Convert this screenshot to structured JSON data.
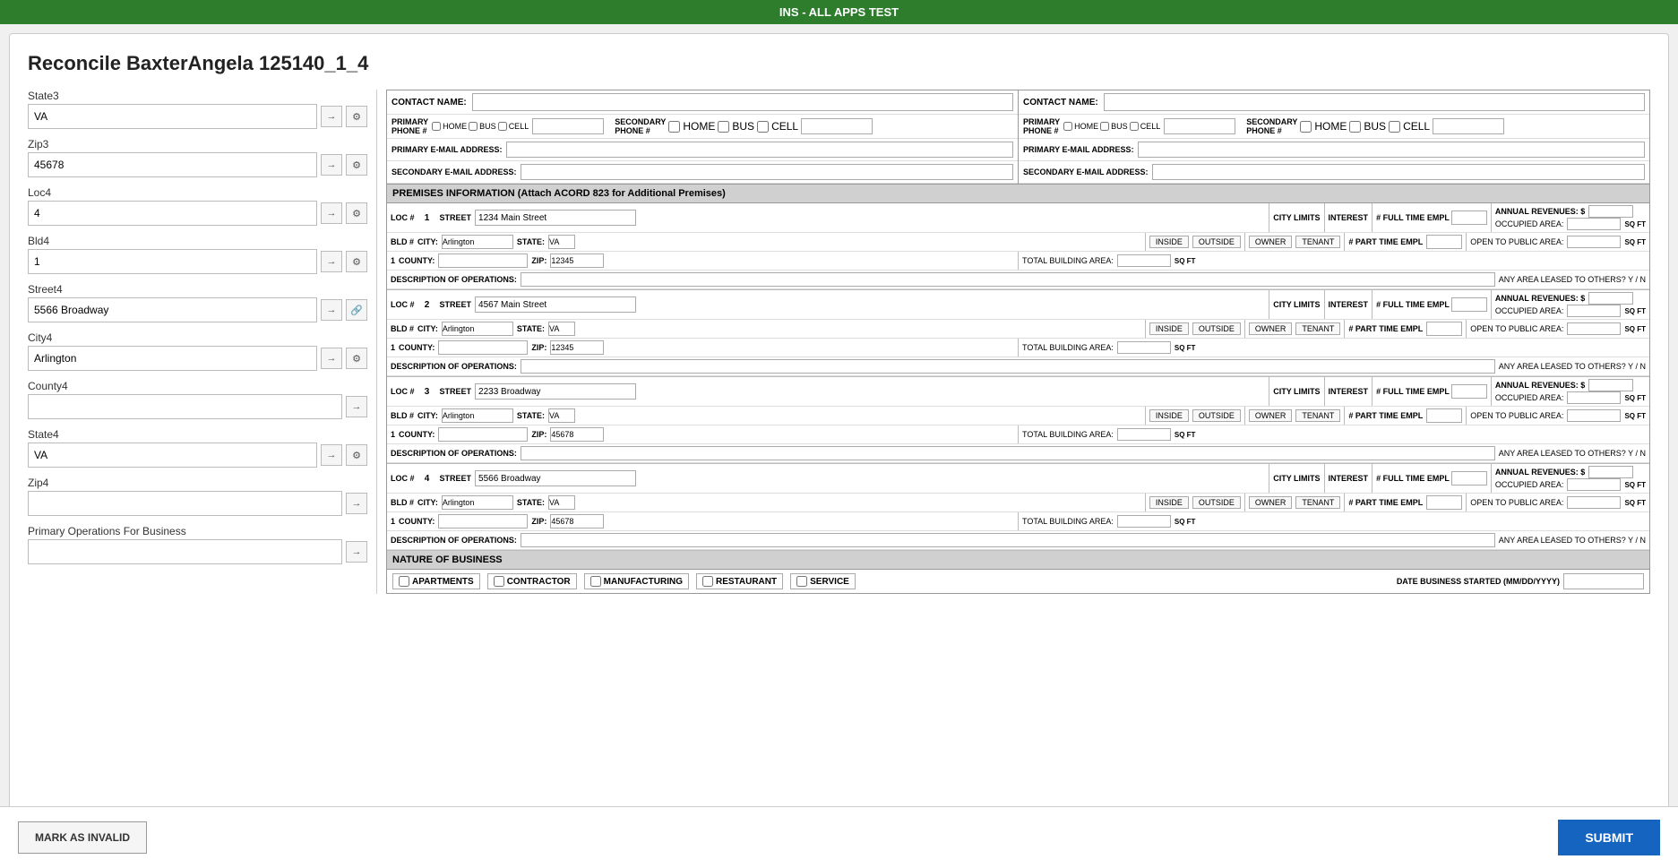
{
  "topBar": {
    "title": "INS - ALL APPS TEST"
  },
  "pageTitle": "Reconcile BaxterAngela 125140_1_4",
  "sidebar": {
    "fields": [
      {
        "id": "state3",
        "label": "State3",
        "value": "VA"
      },
      {
        "id": "zip3",
        "label": "Zip3",
        "value": "45678"
      },
      {
        "id": "loc4",
        "label": "Loc4",
        "value": "4"
      },
      {
        "id": "bld4",
        "label": "Bld4",
        "value": "1"
      },
      {
        "id": "street4",
        "label": "Street4",
        "value": "5566 Broadway"
      },
      {
        "id": "city4",
        "label": "City4",
        "value": "Arlington"
      },
      {
        "id": "county4",
        "label": "County4",
        "value": ""
      },
      {
        "id": "state4",
        "label": "State4",
        "value": "VA"
      },
      {
        "id": "zip4",
        "label": "Zip4",
        "value": ""
      },
      {
        "id": "primaryOps",
        "label": "Primary Operations For Business",
        "value": ""
      }
    ]
  },
  "form": {
    "contactSection": {
      "contact1": {
        "nameLabel": "CONTACT NAME:",
        "primaryPhoneLabel": "PRIMARY PHONE #",
        "secondaryPhoneLabel": "SECONDARY PHONE #",
        "primaryEmailLabel": "PRIMARY E-MAIL ADDRESS:",
        "secondaryEmailLabel": "SECONDARY E-MAIL ADDRESS:",
        "phoneTypes": [
          "HOME",
          "BUS",
          "CELL"
        ],
        "secondaryPhoneTypes": [
          "HOME",
          "BUS",
          "CELL"
        ]
      },
      "contact2": {
        "nameLabel": "CONTACT NAME:",
        "primaryPhoneLabel": "PRIMARY PHONE #",
        "secondaryPhoneLabel": "SECONDARY PHONE #",
        "primaryEmailLabel": "PRIMARY E-MAIL ADDRESS:",
        "secondaryEmailLabel": "SECONDARY E-MAIL ADDRESS:",
        "phoneTypes": [
          "HOME",
          "BUS",
          "CELL"
        ],
        "secondaryPhoneTypes": [
          "HOME",
          "BUS",
          "CELL"
        ]
      }
    },
    "premisesHeader": "PREMISES INFORMATION  (Attach ACORD 823 for Additional Premises)",
    "premises": [
      {
        "loc": "1",
        "bld": "1",
        "street": "1234 Main Street",
        "city": "Arlington",
        "state": "VA",
        "county": "",
        "zip": "12345",
        "cityLimits": "CITY LIMITS",
        "insideLabel": "INSIDE",
        "outsideLabel": "OUTSIDE",
        "interest": "INTEREST",
        "ownerLabel": "OWNER",
        "tenantLabel": "TENANT",
        "fullTimeEmpl": "# FULL TIME EMPL",
        "partTimeEmpl": "# PART TIME EMPL",
        "annualRevenues": "ANNUAL REVENUES: $",
        "occupiedArea": "OCCUPIED AREA:",
        "openToPublic": "OPEN TO PUBLIC AREA:",
        "totalBuilding": "TOTAL BUILDING AREA:",
        "areaLeased": "ANY AREA LEASED TO OTHERS?",
        "descOps": "DESCRIPTION OF OPERATIONS:"
      },
      {
        "loc": "2",
        "bld": "1",
        "street": "4567 Main Street",
        "city": "Arlington",
        "state": "VA",
        "county": "",
        "zip": "12345",
        "cityLimits": "CITY LIMITS",
        "insideLabel": "INSIDE",
        "outsideLabel": "OUTSIDE",
        "interest": "INTEREST",
        "ownerLabel": "OWNER",
        "tenantLabel": "TENANT",
        "fullTimeEmpl": "# FULL TIME EMPL",
        "partTimeEmpl": "# PART TIME EMPL",
        "annualRevenues": "ANNUAL REVENUES: $",
        "occupiedArea": "OCCUPIED AREA:",
        "openToPublic": "OPEN TO PUBLIC AREA:",
        "totalBuilding": "TOTAL BUILDING AREA:",
        "areaLeased": "ANY AREA LEASED TO OTHERS?",
        "descOps": "DESCRIPTION OF OPERATIONS:"
      },
      {
        "loc": "3",
        "bld": "1",
        "street": "2233 Broadway",
        "city": "Arlington",
        "state": "VA",
        "county": "",
        "zip": "45678",
        "cityLimits": "CITY LIMITS",
        "insideLabel": "INSIDE",
        "outsideLabel": "OUTSIDE",
        "interest": "INTEREST",
        "ownerLabel": "OWNER",
        "tenantLabel": "TENANT",
        "fullTimeEmpl": "# FULL TIME EMPL",
        "partTimeEmpl": "# PART TIME EMPL",
        "annualRevenues": "ANNUAL REVENUES: $",
        "occupiedArea": "OCCUPIED AREA:",
        "openToPublic": "OPEN TO PUBLIC AREA:",
        "totalBuilding": "TOTAL BUILDING AREA:",
        "areaLeased": "ANY AREA LEASED TO OTHERS?",
        "descOps": "DESCRIPTION OF OPERATIONS:"
      },
      {
        "loc": "4",
        "bld": "1",
        "street": "5566 Broadway",
        "city": "Arlington",
        "state": "VA",
        "county": "",
        "zip": "45678",
        "cityLimits": "CITY LIMITS",
        "insideLabel": "INSIDE",
        "outsideLabel": "OUTSIDE",
        "interest": "INTEREST",
        "ownerLabel": "OWNER",
        "tenantLabel": "TENANT",
        "fullTimeEmpl": "# FULL TIME EMPL",
        "partTimeEmpl": "# PART TIME EMPL",
        "annualRevenues": "ANNUAL REVENUES: $",
        "occupiedArea": "OCCUPIED AREA:",
        "openToPublic": "OPEN TO PUBLIC AREA:",
        "totalBuilding": "TOTAL BUILDING AREA:",
        "areaLeased": "ANY AREA LEASED TO OTHERS?",
        "descOps": "DESCRIPTION OF OPERATIONS:"
      }
    ],
    "natureOfBusiness": {
      "header": "NATURE OF BUSINESS",
      "types": [
        "APARTMENTS",
        "CONTRACTOR",
        "MANUFACTURING",
        "RESTAURANT",
        "SERVICE"
      ],
      "dateLabel": "DATE BUSINESS STARTED (MM/DD/YYYY)"
    }
  },
  "bottomBar": {
    "markInvalidLabel": "MARK AS INVALID",
    "submitLabel": "SUBMIT"
  },
  "icons": {
    "arrow": "→",
    "gear": "⚙",
    "link": "🔗"
  }
}
